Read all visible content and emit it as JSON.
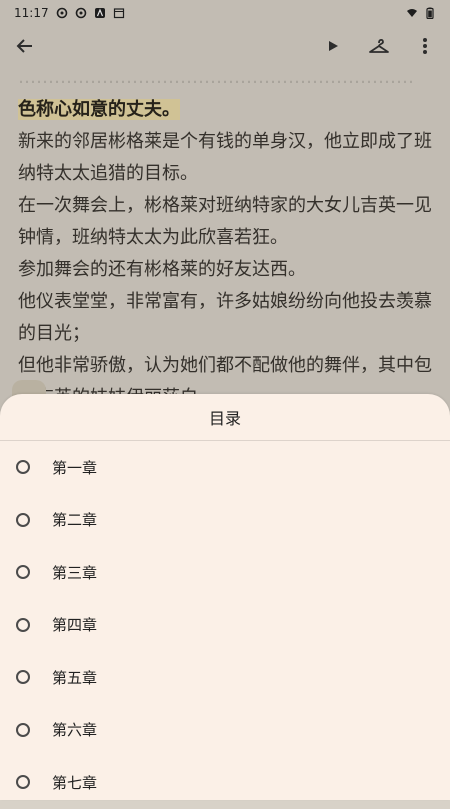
{
  "status_bar": {
    "time": "11:17",
    "icons": [
      "gear-icon",
      "gear-icon",
      "text-a-icon",
      "calendar-icon"
    ],
    "right_icons": [
      "wifi-icon",
      "battery-icon"
    ]
  },
  "toolbar": {
    "back_icon": "arrow-left-icon",
    "actions": [
      "play-icon",
      "hanger-icon",
      "more-vertical-icon"
    ]
  },
  "reader": {
    "top_ghost": "…………………………………………………………",
    "ghost2": "…………………………………………………………",
    "highlight_line": "色称心如意的丈夫。",
    "paragraphs": [
      " 新来的邻居彬格莱是个有钱的单身汉，他立即成了班纳特太太追猎的目标。",
      "在一次舞会上，彬格莱对班纳特家的大女儿吉英一见钟情，班纳特太太为此欣喜若狂。",
      " 参加舞会的还有彬格莱的好友达西。",
      "他仪表堂堂，非常富有，许多姑娘纷纷向他投去羡慕的目光；",
      "但他非常骄傲，认为她们都不配做他的舞伴，其中包括吉英的妹妹伊丽莎白。"
    ]
  },
  "toc": {
    "title": "目录",
    "chapters": [
      {
        "label": "第一章"
      },
      {
        "label": "第二章"
      },
      {
        "label": "第三章"
      },
      {
        "label": "第四章"
      },
      {
        "label": "第五章"
      },
      {
        "label": "第六章"
      },
      {
        "label": "第七章"
      }
    ]
  }
}
